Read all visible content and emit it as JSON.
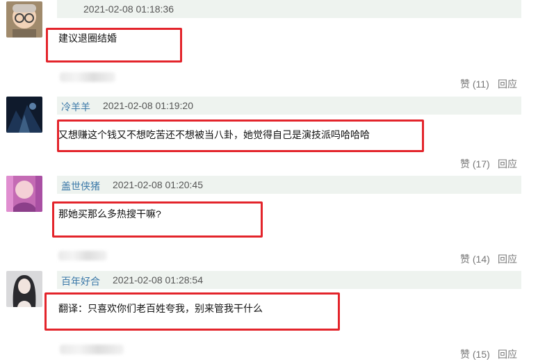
{
  "comments": [
    {
      "username": "",
      "timestamp": "2021-02-08 01:18:36",
      "text": "建议退圈结婚",
      "like_label": "赞",
      "like_count": "(11)",
      "reply_label": "回应",
      "avatar_icon": "child-photo-avatar"
    },
    {
      "username": "冷羊羊",
      "timestamp": "2021-02-08 01:19:20",
      "text": "又想赚这个钱又不想吃苦还不想被当八卦，她觉得自己是演技派吗哈哈哈",
      "like_label": "赞",
      "like_count": "(17)",
      "reply_label": "回应",
      "avatar_icon": "night-scene-avatar"
    },
    {
      "username": "盖世侠猪",
      "timestamp": "2021-02-08 01:20:45",
      "text": "那她买那么多热搜干嘛?",
      "like_label": "赞",
      "like_count": "(14)",
      "reply_label": "回应",
      "avatar_icon": "pink-photo-avatar"
    },
    {
      "username": "百年好合",
      "timestamp": "2021-02-08 01:28:54",
      "text": "翻译：只喜欢你们老百姓夸我，别来管我干什么",
      "like_label": "赞",
      "like_count": "(15)",
      "reply_label": "回应",
      "avatar_icon": "illustration-avatar"
    }
  ],
  "colors": {
    "highlight_box": "#e3242b",
    "meta_bar": "#eef3ef",
    "username": "#3b78a8"
  }
}
